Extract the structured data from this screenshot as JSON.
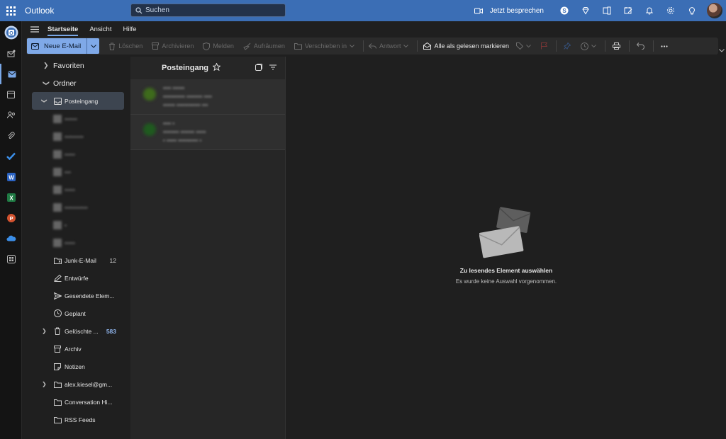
{
  "header": {
    "app_title": "Outlook",
    "search_placeholder": "Suchen",
    "meet_label": "Jetzt besprechen"
  },
  "ribbon": {
    "tabs": [
      {
        "label": "Startseite",
        "active": true
      },
      {
        "label": "Ansicht",
        "active": false
      },
      {
        "label": "Hilfe",
        "active": false
      }
    ],
    "new_mail": "Neue E-Mail",
    "delete": "Löschen",
    "archive": "Archivieren",
    "report": "Melden",
    "sweep": "Aufräumen",
    "move": "Verschieben in",
    "reply": "Antwort",
    "mark_all_read": "Alle als gelesen markieren"
  },
  "folders": {
    "favorites": "Favoriten",
    "folders_header": "Ordner",
    "inbox": "Posteingang",
    "blurred": [
      "••••••",
      "•••••••••",
      "•••••",
      "•••",
      "•••••",
      "•••••••••••",
      "•",
      "•••••"
    ],
    "junk": {
      "label": "Junk-E-Mail",
      "count": "12"
    },
    "drafts": "Entwürfe",
    "sent": "Gesendete Elem...",
    "scheduled": "Geplant",
    "deleted": {
      "label": "Gelöschte ...",
      "count": "583"
    },
    "archive": "Archiv",
    "notes": "Notizen",
    "account": "alex.kiesel@gm...",
    "conversation": "Conversation Hi...",
    "rss": "RSS Feeds"
  },
  "message_list": {
    "title": "Posteingang",
    "messages": [
      {
        "sender": "•••• ••••••",
        "line2": "••••••••••• •••••••• ••••",
        "line3": "•••••• •••••••••••• •••",
        "avatar_color": "#3e6b1c"
      },
      {
        "sender": "•••• •",
        "line2": "•••••••• ••••••• •••••",
        "line3": "• ••••• •••••••••• •",
        "avatar_color": "#1f5a1f"
      }
    ]
  },
  "reading_pane": {
    "empty_title": "Zu lesendes Element auswählen",
    "empty_subtitle": "Es wurde keine Auswahl vorgenommen."
  }
}
